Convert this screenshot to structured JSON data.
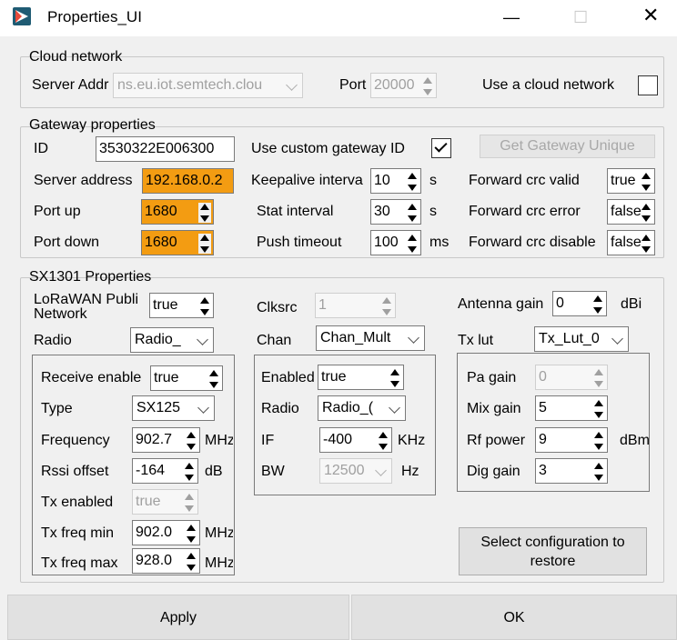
{
  "window": {
    "title": "Properties_UI",
    "controls": [
      "—",
      "☐",
      "✕"
    ]
  },
  "cloud": {
    "title": "Cloud network",
    "server_label": "Server Addr",
    "server_value": "ns.eu.iot.semtech.clou",
    "port_label": "Port",
    "port_value": "20000",
    "use_cloud_label": "Use a cloud network",
    "use_cloud_checked": false
  },
  "gateway": {
    "title": "Gateway properties",
    "id_label": "ID",
    "id_value": "3530322E006300",
    "custom_id_label": "Use custom gateway ID",
    "custom_id_checked": true,
    "unique_button": "Get Gateway Unique",
    "server_label": "Server address",
    "server_value": "192.168.0.2",
    "port_up_label": "Port up",
    "port_up_value": "1680",
    "port_down_label": "Port down",
    "port_down_value": "1680",
    "keepalive_label": "Keepalive interva",
    "keepalive_value": "10",
    "keepalive_unit": "s",
    "stat_label": "Stat interval",
    "stat_value": "30",
    "stat_unit": "s",
    "push_label": "Push timeout",
    "push_value": "100",
    "push_unit": "ms",
    "crc_valid_label": "Forward crc valid",
    "crc_valid_value": "true",
    "crc_error_label": "Forward crc error",
    "crc_error_value": "false",
    "crc_disable_label": "Forward crc disable",
    "crc_disable_value": "false"
  },
  "sx1301": {
    "title": "SX1301 Properties",
    "lorawan_label_1": "LoRaWAN Publi",
    "lorawan_label_2": "Network",
    "lorawan_value": "true",
    "radio_label": "Radio",
    "radio_value": "Radio_",
    "clksrc_label": "Clksrc",
    "clksrc_value": "1",
    "chan_label": "Chan",
    "chan_value": "Chan_Mult",
    "antenna_label": "Antenna gain",
    "antenna_value": "0",
    "antenna_unit": "dBi",
    "txlut_label": "Tx lut",
    "txlut_value": "Tx_Lut_0",
    "radio_panel": {
      "receive_label": "Receive enable",
      "receive_value": "true",
      "type_label": "Type",
      "type_value": "SX125",
      "freq_label": "Frequency",
      "freq_value": "902.7",
      "freq_unit": "MHz",
      "rssi_label": "Rssi offset",
      "rssi_value": "-164",
      "rssi_unit": "dB",
      "tx_enabled_label": "Tx enabled",
      "tx_enabled_value": "true",
      "tx_min_label": "Tx freq min",
      "tx_min_value": "902.0",
      "tx_min_unit": "MHz",
      "tx_max_label": "Tx freq max",
      "tx_max_value": "928.0",
      "tx_max_unit": "MHz"
    },
    "chan_panel": {
      "enabled_label": "Enabled",
      "enabled_value": "true",
      "radio_label": "Radio",
      "radio_value": "Radio_(",
      "if_label": "IF",
      "if_value": "-400",
      "if_unit": "KHz",
      "bw_label": "BW",
      "bw_value": "12500",
      "bw_unit": "Hz"
    },
    "lut_panel": {
      "pa_label": "Pa gain",
      "pa_value": "0",
      "mix_label": "Mix gain",
      "mix_value": "5",
      "rf_label": "Rf power",
      "rf_value": "9",
      "rf_unit": "dBm",
      "dig_label": "Dig gain",
      "dig_value": "3"
    },
    "restore_line1": "Select configuration to",
    "restore_line2": "restore"
  },
  "footer": {
    "apply": "Apply",
    "ok": "OK"
  }
}
